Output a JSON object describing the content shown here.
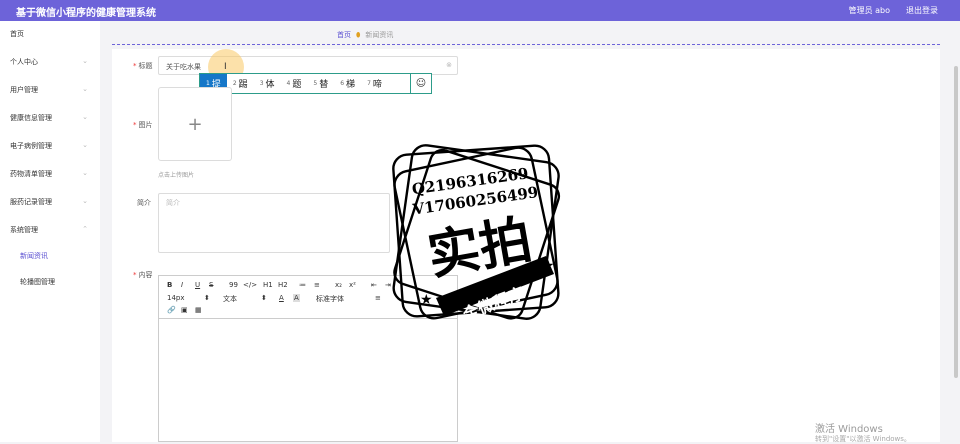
{
  "app": {
    "title": "基于微信小程序的健康管理系统",
    "user_label": "管理员 abo",
    "logout_label": "退出登录"
  },
  "sidebar": {
    "items": [
      {
        "label": "首页",
        "chevron": ""
      },
      {
        "label": "个人中心",
        "chevron": "⌄"
      },
      {
        "label": "用户管理",
        "chevron": "⌄"
      },
      {
        "label": "健康信息管理",
        "chevron": "⌄"
      },
      {
        "label": "电子病例管理",
        "chevron": "⌄"
      },
      {
        "label": "药物清单管理",
        "chevron": "⌄"
      },
      {
        "label": "服药记录管理",
        "chevron": "⌄"
      },
      {
        "label": "系统管理",
        "chevron": "⌃"
      },
      {
        "label": "新闻资讯",
        "chevron": ""
      },
      {
        "label": "轮播图管理",
        "chevron": ""
      }
    ]
  },
  "breadcrumb": {
    "home": "首页",
    "current": "新闻资讯"
  },
  "form": {
    "title_label": "标题",
    "title_value": "关于吃水果",
    "title_clear": "⊗",
    "image_label": "图片",
    "upload_plus": "+",
    "upload_hint": "点击上传图片",
    "intro_label": "简介",
    "intro_placeholder": "简介",
    "content_label": "内容",
    "required_mark": "*"
  },
  "ime": {
    "candidates": [
      {
        "num": "1",
        "text": "提"
      },
      {
        "num": "2",
        "text": "踢"
      },
      {
        "num": "3",
        "text": "体"
      },
      {
        "num": "4",
        "text": "题"
      },
      {
        "num": "5",
        "text": "替"
      },
      {
        "num": "6",
        "text": "梯"
      },
      {
        "num": "7",
        "text": "啼"
      }
    ],
    "emoji": "☺"
  },
  "editor": {
    "row1": [
      "B",
      "I",
      "U",
      "S",
      "99",
      "</>",
      "H1",
      "H2",
      "≔",
      "≡",
      "x₂",
      "x²",
      "⇤",
      "⇥"
    ],
    "font_size": "14px",
    "font_kind": "文本",
    "font_family": "标准字体",
    "row2_icons": [
      "A",
      "A"
    ],
    "row3_icons": [
      "link-icon",
      "image-icon",
      "video-icon"
    ]
  },
  "stamp": {
    "qq": "Q2196316269",
    "v": "V17060256499",
    "big": "实拍",
    "banner": "全微程序"
  },
  "watermark": {
    "line1": "激活 Windows",
    "line2": "转到\"设置\"以激活 Windows。"
  },
  "colors": {
    "accent": "#6d63d9",
    "ime_selected": "#1677c8",
    "required": "#ee3333"
  }
}
